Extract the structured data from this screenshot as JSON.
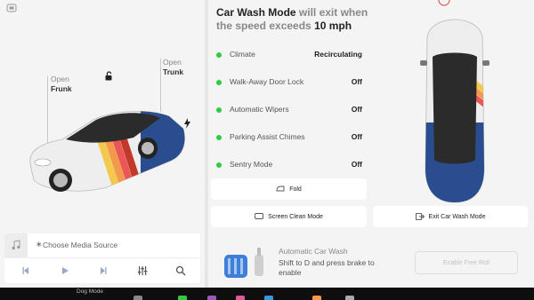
{
  "left_panel": {
    "frunk": {
      "action": "Open",
      "name": "Frunk"
    },
    "trunk": {
      "action": "Open",
      "name": "Trunk"
    },
    "media": {
      "source_label": "Choose Media Source"
    }
  },
  "car_wash": {
    "title_bold": "Car Wash Mode",
    "title_muted": " will exit when",
    "title_line2_muted": "the speed exceeds ",
    "title_speed": "10 mph",
    "settings": [
      {
        "label": "Climate",
        "value": "Recirculating"
      },
      {
        "label": "Walk-Away Door Lock",
        "value": "Off"
      },
      {
        "label": "Automatic Wipers",
        "value": "Off"
      },
      {
        "label": "Parking Assist Chimes",
        "value": "Off"
      },
      {
        "label": "Sentry Mode",
        "value": "Off"
      }
    ],
    "fold_label": "Fold",
    "screen_clean_label": "Screen Clean Mode",
    "exit_label": "Exit Car Wash Mode",
    "auto_title": "Automatic Car Wash",
    "auto_desc": "Shift to D and press brake to enable",
    "free_roll_label": "Enable Free Roll",
    "status_color": "#2ecc40"
  },
  "taskbar": {
    "dog_mode_label": "Dog Mode"
  },
  "icons": [
    "car-profile-icon",
    "unlock-icon",
    "charge-bolt-icon",
    "music-note-icon",
    "bluetooth-icon",
    "previous-icon",
    "play-icon",
    "next-icon",
    "equalizer-icon",
    "search-icon",
    "fold-mirror-icon",
    "screen-icon",
    "exit-icon",
    "car-wash-icon",
    "speed-limit-icon"
  ]
}
